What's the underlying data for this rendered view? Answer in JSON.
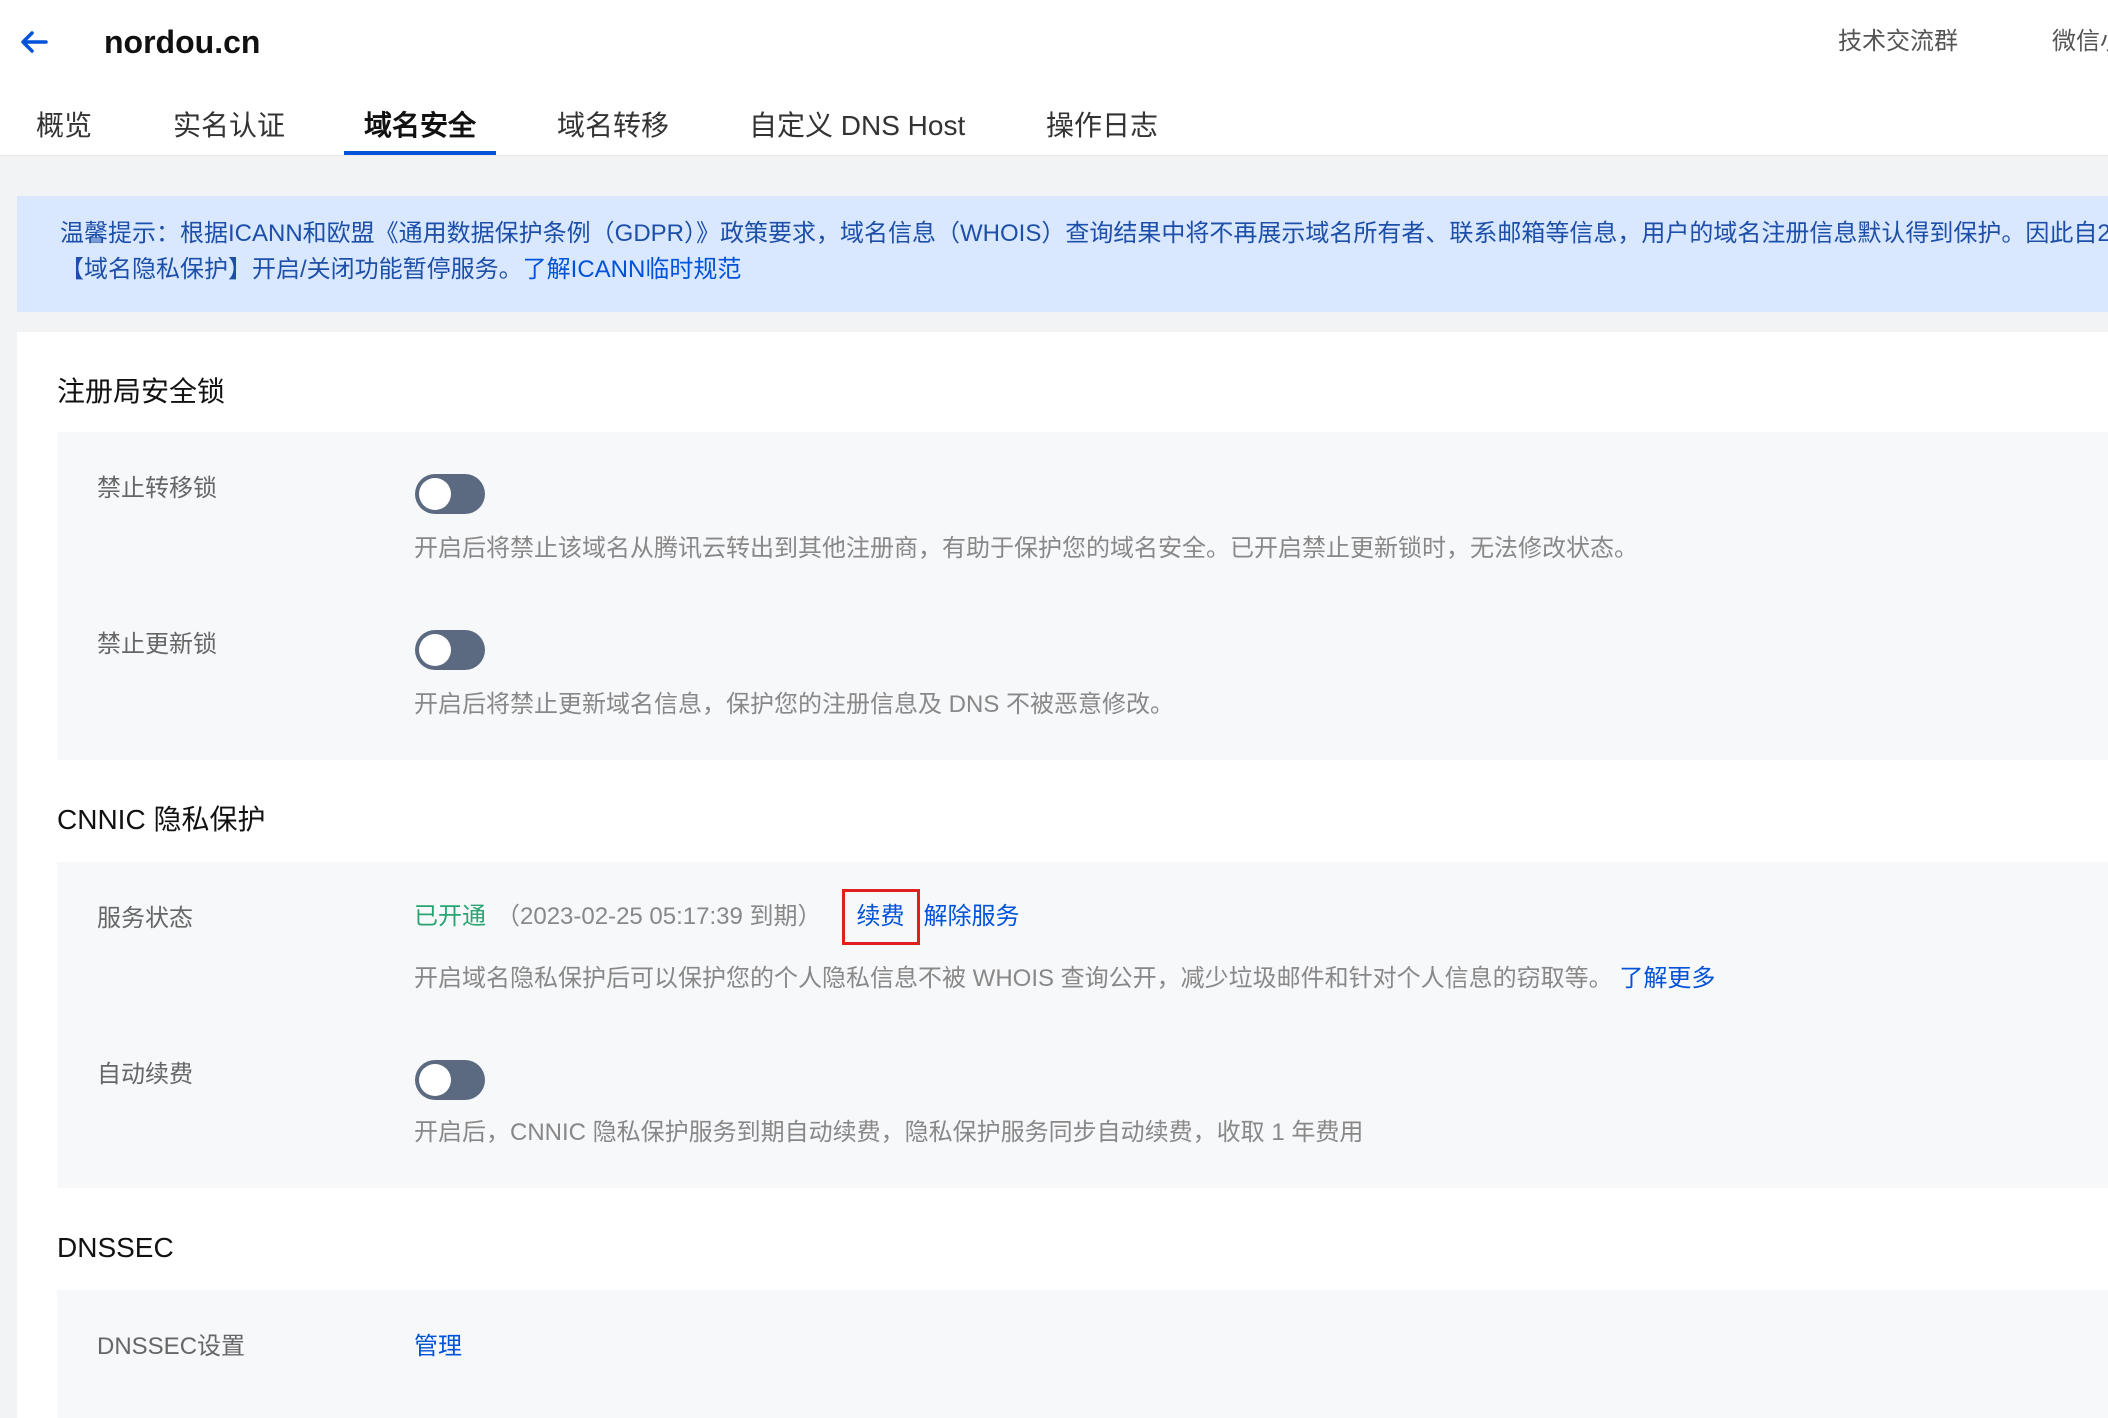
{
  "header": {
    "domain": "nordou.cn",
    "links": [
      "技术交流群",
      "微信小"
    ]
  },
  "tabs": [
    {
      "label": "概览"
    },
    {
      "label": "实名认证"
    },
    {
      "label": "域名安全",
      "active": true
    },
    {
      "label": "域名转移"
    },
    {
      "label": "自定义 DNS Host"
    },
    {
      "label": "操作日志"
    }
  ],
  "notice": {
    "line1": "温馨提示：根据ICANN和欧盟《通用数据保护条例（GDPR）》政策要求，域名信息（WHOIS）查询结果中将不再展示域名所有者、联系邮箱等信息，用户的域名注册信息默认得到保护。因此自2",
    "line2": "【域名隐私保护】开启/关闭功能暂停服务。",
    "link": "了解ICANN临时规范"
  },
  "registry_lock": {
    "title": "注册局安全锁",
    "transfer_lock": {
      "label": "禁止转移锁",
      "enabled": false,
      "desc": "开启后将禁止该域名从腾讯云转出到其他注册商，有助于保护您的域名安全。已开启禁止更新锁时，无法修改状态。"
    },
    "update_lock": {
      "label": "禁止更新锁",
      "enabled": false,
      "desc": "开启后将禁止更新域名信息，保护您的注册信息及 DNS 不被恶意修改。"
    }
  },
  "privacy": {
    "title": "CNNIC 隐私保护",
    "service_label": "服务状态",
    "status": "已开通",
    "expiry": "（2023-02-25 05:17:39 到期）",
    "renew": "续费",
    "cancel": "解除服务",
    "desc": "开启域名隐私保护后可以保护您的个人隐私信息不被 WHOIS 查询公开，减少垃圾邮件和针对个人信息的窃取等。",
    "learn_more": "了解更多",
    "auto_renew_label": "自动续费",
    "auto_renew_enabled": false,
    "auto_renew_desc": "开启后，CNNIC 隐私保护服务到期自动续费，隐私保护服务同步自动续费，收取 1 年费用"
  },
  "dnssec": {
    "title": "DNSSEC",
    "label": "DNSSEC设置",
    "manage": "管理"
  },
  "colors": {
    "primary": "#0052d9",
    "success": "#2ba471",
    "notice_bg": "#d9e8ff",
    "highlight": "#e02020"
  }
}
